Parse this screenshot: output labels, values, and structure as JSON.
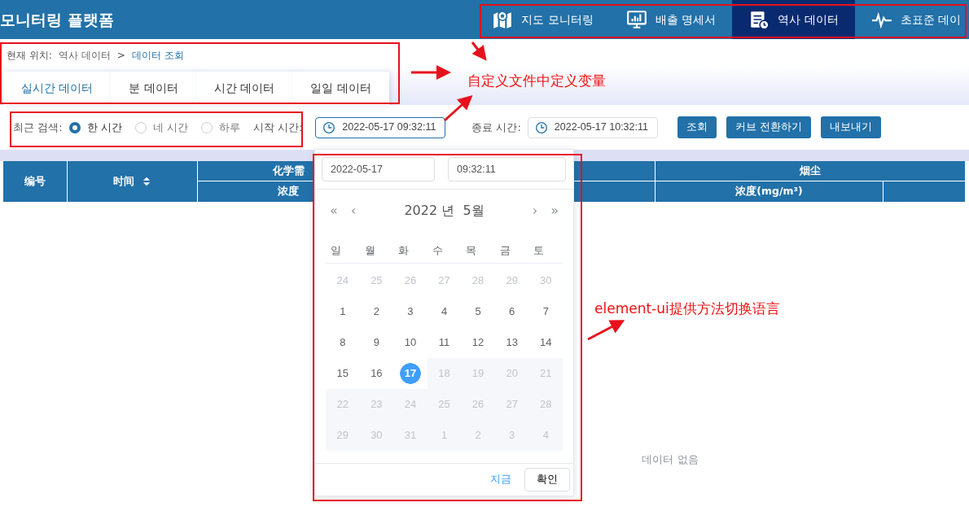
{
  "header": {
    "title": "모니터링 플랫폼",
    "nav": [
      {
        "label": "지도 모니터링",
        "selected": false
      },
      {
        "label": "배출 명세서",
        "selected": false
      },
      {
        "label": "역사 데이터",
        "selected": true
      },
      {
        "label": "초표준 데이",
        "selected": false
      }
    ]
  },
  "breadcrumb": {
    "label": "현재 위치:",
    "items": [
      {
        "text": "역사 데이터",
        "current": false
      },
      {
        "text": "데이터 조회",
        "current": true
      }
    ],
    "separator": ">"
  },
  "tabs": [
    {
      "label": "실시간 데이터",
      "selected": true
    },
    {
      "label": "분 데이터",
      "selected": false
    },
    {
      "label": "시간 데이터",
      "selected": false
    },
    {
      "label": "일일 데이터",
      "selected": false
    }
  ],
  "filter": {
    "label": "최근 검색:",
    "radios": [
      {
        "label": "한 시간",
        "selected": true
      },
      {
        "label": "네 시간",
        "selected": false
      },
      {
        "label": "하루",
        "selected": false
      }
    ],
    "start_label": "시작 시간:",
    "start_value": "2022-05-17 09:32:11",
    "end_label": "종료 시간:",
    "end_value": "2022-05-17 10:32:11",
    "buttons": [
      "조회",
      "커브 전환하기",
      "내보내기"
    ]
  },
  "table": {
    "header_row_1": [
      "编号",
      "时间",
      "化学需",
      "烟尘"
    ],
    "header_row_2": [
      "浓度",
      "浓度(mg/m³)"
    ],
    "empty_text": "데이터 없음"
  },
  "date_picker": {
    "date_value": "2022-05-17",
    "time_value": "09:32:11",
    "prev_year": "«",
    "prev_month": "‹",
    "title": "2022 년  5월",
    "next_month": "›",
    "next_year": "»",
    "weekdays": [
      "일",
      "월",
      "화",
      "수",
      "목",
      "금",
      "토"
    ],
    "weeks": [
      [
        {
          "day": "24",
          "kind": "other-month",
          "selected": false
        },
        {
          "day": "25",
          "kind": "other-month",
          "selected": false
        },
        {
          "day": "26",
          "kind": "other-month",
          "selected": false
        },
        {
          "day": "27",
          "kind": "other-month",
          "selected": false
        },
        {
          "day": "28",
          "kind": "other-month",
          "selected": false
        },
        {
          "day": "29",
          "kind": "other-month",
          "selected": false
        },
        {
          "day": "30",
          "kind": "other-month",
          "selected": false
        }
      ],
      [
        {
          "day": "1",
          "kind": "current",
          "selected": false
        },
        {
          "day": "2",
          "kind": "current",
          "selected": false
        },
        {
          "day": "3",
          "kind": "current",
          "selected": false
        },
        {
          "day": "4",
          "kind": "current",
          "selected": false
        },
        {
          "day": "5",
          "kind": "current",
          "selected": false
        },
        {
          "day": "6",
          "kind": "current",
          "selected": false
        },
        {
          "day": "7",
          "kind": "current",
          "selected": false
        }
      ],
      [
        {
          "day": "8",
          "kind": "current",
          "selected": false
        },
        {
          "day": "9",
          "kind": "current",
          "selected": false
        },
        {
          "day": "10",
          "kind": "current",
          "selected": false
        },
        {
          "day": "11",
          "kind": "current",
          "selected": false
        },
        {
          "day": "12",
          "kind": "current",
          "selected": false
        },
        {
          "day": "13",
          "kind": "current",
          "selected": false
        },
        {
          "day": "14",
          "kind": "current",
          "selected": false
        }
      ],
      [
        {
          "day": "15",
          "kind": "current",
          "selected": false
        },
        {
          "day": "16",
          "kind": "current",
          "selected": false
        },
        {
          "day": "17",
          "kind": "current",
          "selected": true
        },
        {
          "day": "18",
          "kind": "disabled",
          "selected": false
        },
        {
          "day": "19",
          "kind": "disabled",
          "selected": false
        },
        {
          "day": "20",
          "kind": "disabled",
          "selected": false
        },
        {
          "day": "21",
          "kind": "disabled",
          "selected": false
        }
      ],
      [
        {
          "day": "22",
          "kind": "disabled",
          "selected": false
        },
        {
          "day": "23",
          "kind": "disabled",
          "selected": false
        },
        {
          "day": "24",
          "kind": "disabled",
          "selected": false
        },
        {
          "day": "25",
          "kind": "disabled",
          "selected": false
        },
        {
          "day": "26",
          "kind": "disabled",
          "selected": false
        },
        {
          "day": "27",
          "kind": "disabled",
          "selected": false
        },
        {
          "day": "28",
          "kind": "disabled",
          "selected": false
        }
      ],
      [
        {
          "day": "29",
          "kind": "disabled",
          "selected": false
        },
        {
          "day": "30",
          "kind": "disabled",
          "selected": false
        },
        {
          "day": "31",
          "kind": "disabled",
          "selected": false
        },
        {
          "day": "1",
          "kind": "disabled",
          "selected": false
        },
        {
          "day": "2",
          "kind": "disabled",
          "selected": false
        },
        {
          "day": "3",
          "kind": "disabled",
          "selected": false
        },
        {
          "day": "4",
          "kind": "disabled",
          "selected": false
        }
      ]
    ],
    "now_link": "지금",
    "confirm_button": "확인"
  },
  "annotations": [
    {
      "text": "自定义文件中定义变量"
    },
    {
      "text": "element-ui提供方法切换语言"
    }
  ]
}
